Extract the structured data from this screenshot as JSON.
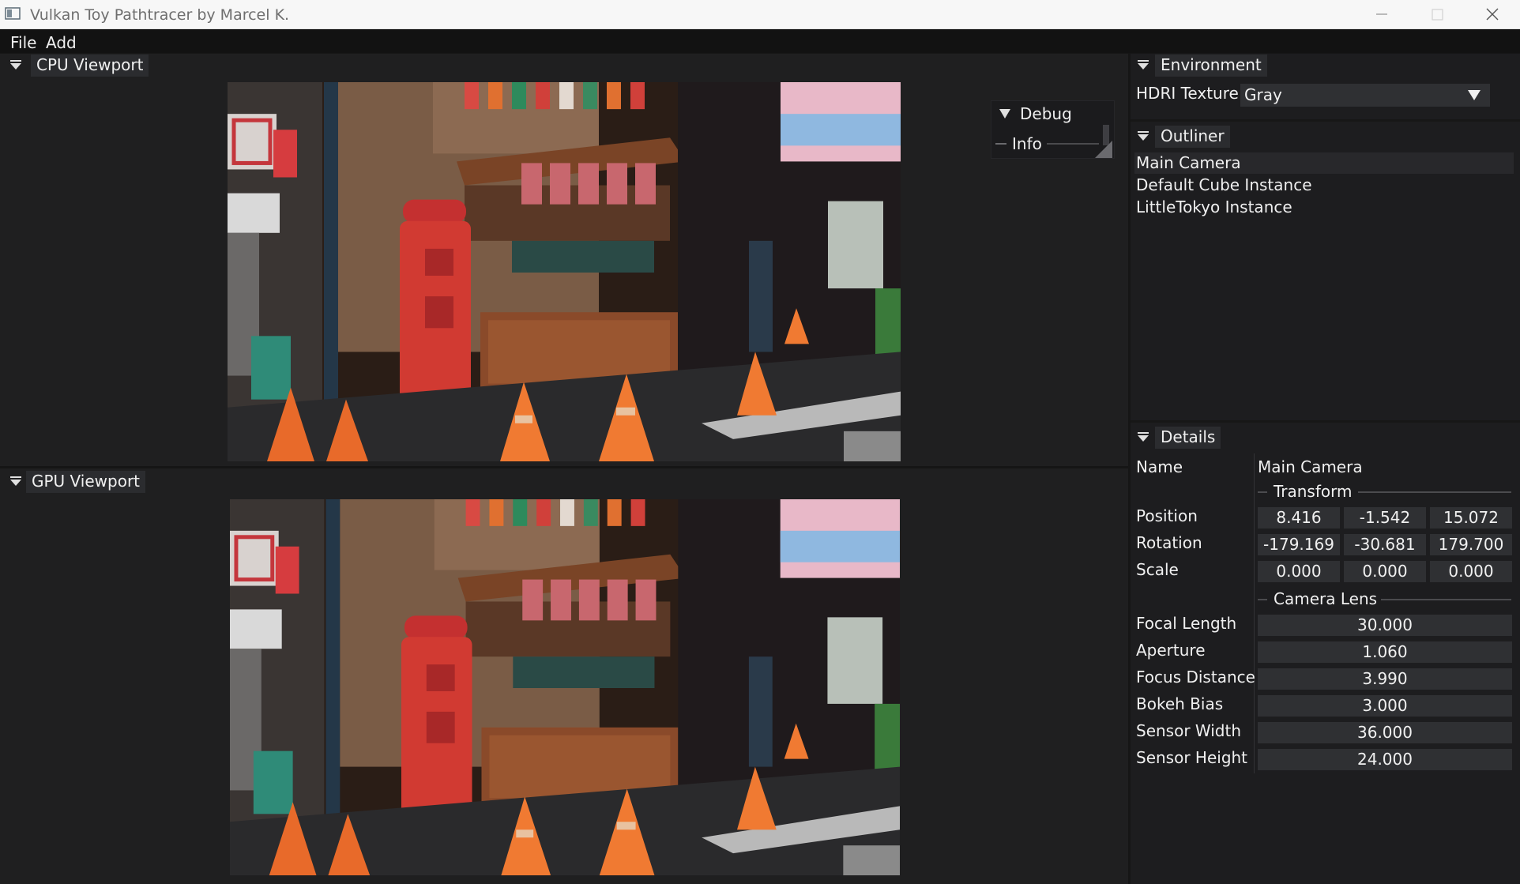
{
  "window": {
    "title": "Vulkan Toy Pathtracer by Marcel K.",
    "icons": [
      "app-icon",
      "minimize-icon",
      "maximize-icon",
      "close-icon"
    ]
  },
  "menu": {
    "file": "File",
    "add": "Add"
  },
  "cpu_viewport": {
    "title": "CPU Viewport"
  },
  "gpu_viewport": {
    "title": "GPU Viewport"
  },
  "debug": {
    "title": "Debug",
    "info_label": "Info"
  },
  "environment": {
    "title": "Environment",
    "hdri_label": "HDRI Texture",
    "hdri_value": "Gray"
  },
  "outliner": {
    "title": "Outliner",
    "items": [
      "Main Camera",
      "Default Cube Instance",
      "LittleTokyo Instance"
    ],
    "selected_index": 0
  },
  "details": {
    "title": "Details",
    "name_label": "Name",
    "name_value": "Main Camera",
    "transform": {
      "title": "Transform",
      "position_label": "Position",
      "position": [
        "8.416",
        "-1.542",
        "15.072"
      ],
      "rotation_label": "Rotation",
      "rotation": [
        "-179.169",
        "-30.681",
        "179.700"
      ],
      "scale_label": "Scale",
      "scale": [
        "0.000",
        "0.000",
        "0.000"
      ]
    },
    "lens": {
      "title": "Camera Lens",
      "focal_length_label": "Focal Length",
      "focal_length": "30.000",
      "aperture_label": "Aperture",
      "aperture": "1.060",
      "focus_distance_label": "Focus Distance",
      "focus_distance": "3.990",
      "bokeh_bias_label": "Bokeh Bias",
      "bokeh_bias": "3.000",
      "sensor_width_label": "Sensor Width",
      "sensor_width": "36.000",
      "sensor_height_label": "Sensor Height",
      "sensor_height": "24.000"
    }
  },
  "colors": {
    "background": "#1d1d1f",
    "header": "#2b2c2f",
    "field": "#2f3033",
    "selected": "#28282b",
    "titlebar": "#f7f7f7"
  }
}
